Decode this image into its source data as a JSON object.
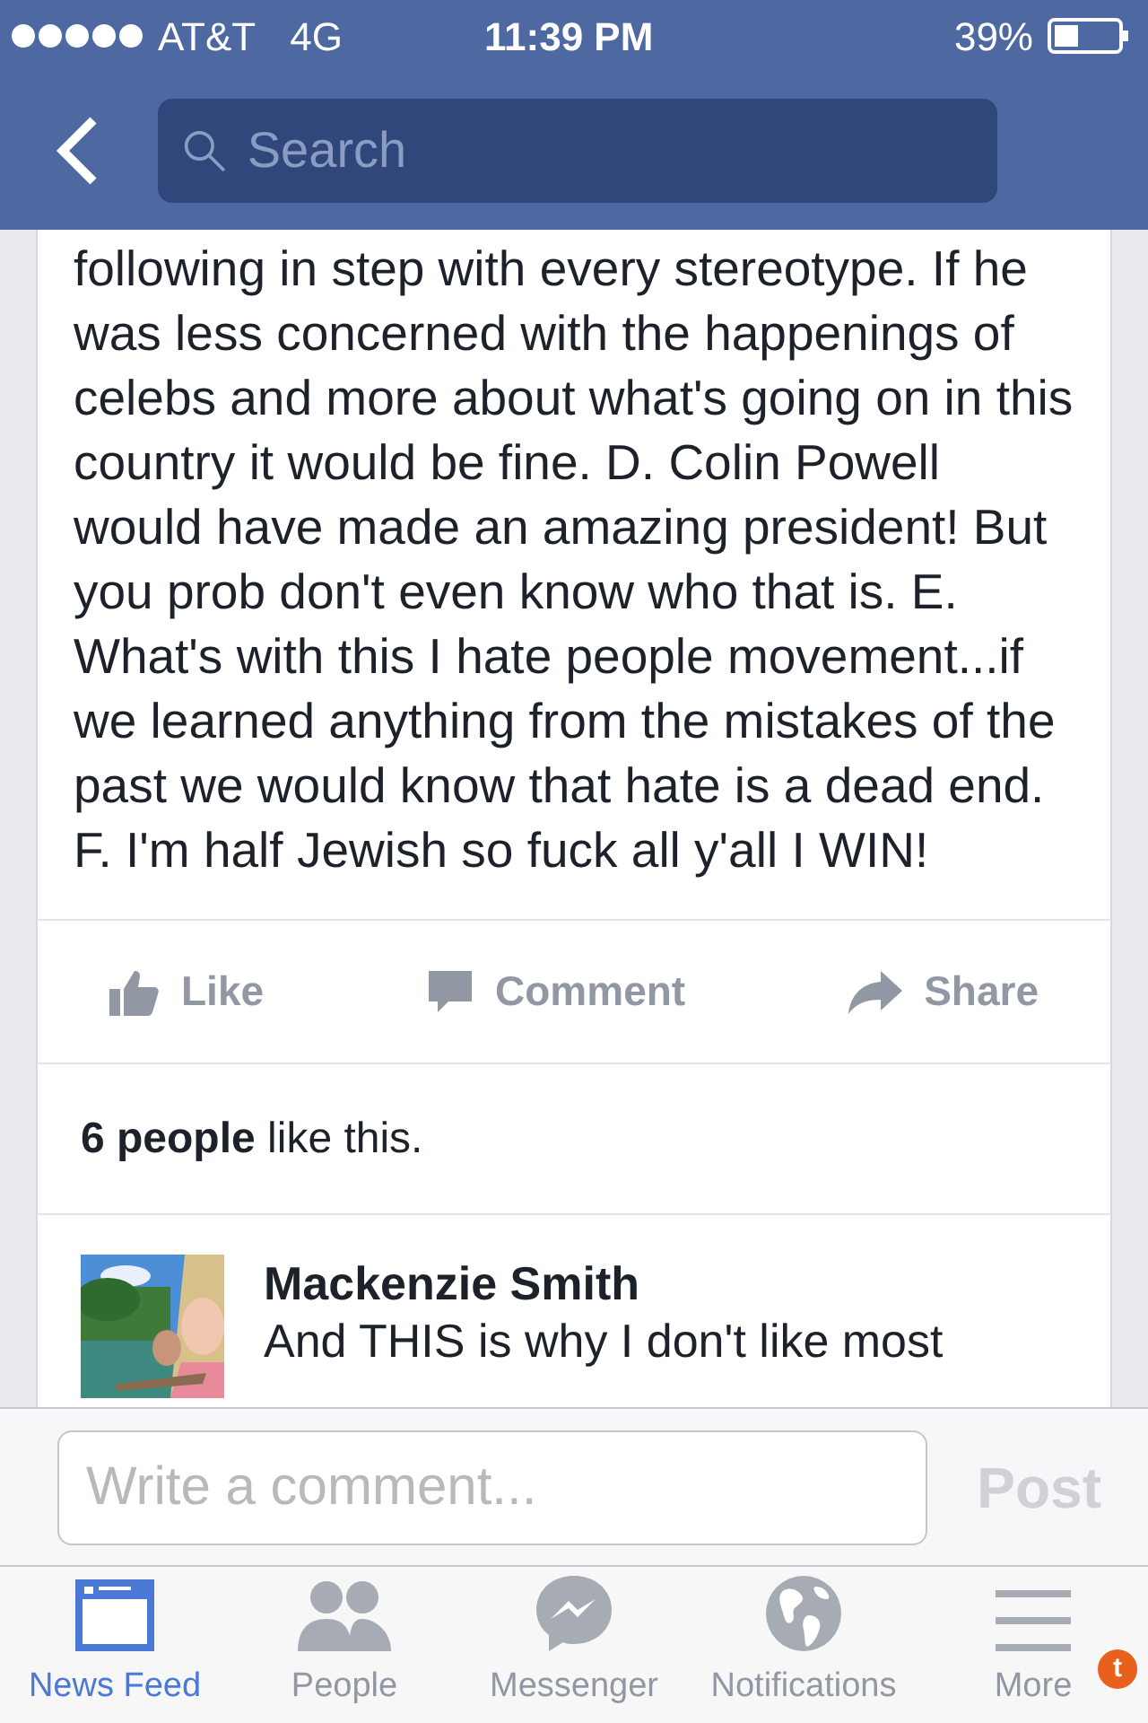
{
  "status_bar": {
    "carrier": "AT&T",
    "network": "4G",
    "time": "11:39 PM",
    "battery": "39%"
  },
  "nav": {
    "search": {
      "placeholder": "Search"
    }
  },
  "post": {
    "text": "following in step with every stereotype. If he was less concerned with the happenings of celebs and more about what's going on in this country it would be fine. D. Colin Powell would have made an amazing president! But you prob don't even know who that is. E. What's with this I hate people movement...if we learned anything from the mistakes of the past we would know that hate is a dead end. F. I'm half Jewish so fuck all y'all I WIN!",
    "actions": [
      {
        "kind": "like",
        "label": "Like"
      },
      {
        "kind": "comment",
        "label": "Comment"
      },
      {
        "kind": "share",
        "label": "Share"
      }
    ],
    "likes": "**6 people** like this.",
    "comments": [
      {
        "author": "Mackenzie Smith",
        "text": "And THIS is why I don't like most"
      }
    ]
  },
  "composer": {
    "placeholder": "Write a comment...",
    "button": "Post",
    "disabled": true
  },
  "tab_bar": [
    {
      "kind": "feed",
      "label": "News Feed",
      "selected": true
    },
    {
      "kind": "people",
      "label": "People",
      "selected": false
    },
    {
      "kind": "messenger",
      "label": "Messenger",
      "selected": false
    },
    {
      "kind": "globe",
      "label": "Notifications",
      "selected": false
    },
    {
      "kind": "menu",
      "label": "More",
      "selected": false,
      "badge": "t"
    }
  ]
}
